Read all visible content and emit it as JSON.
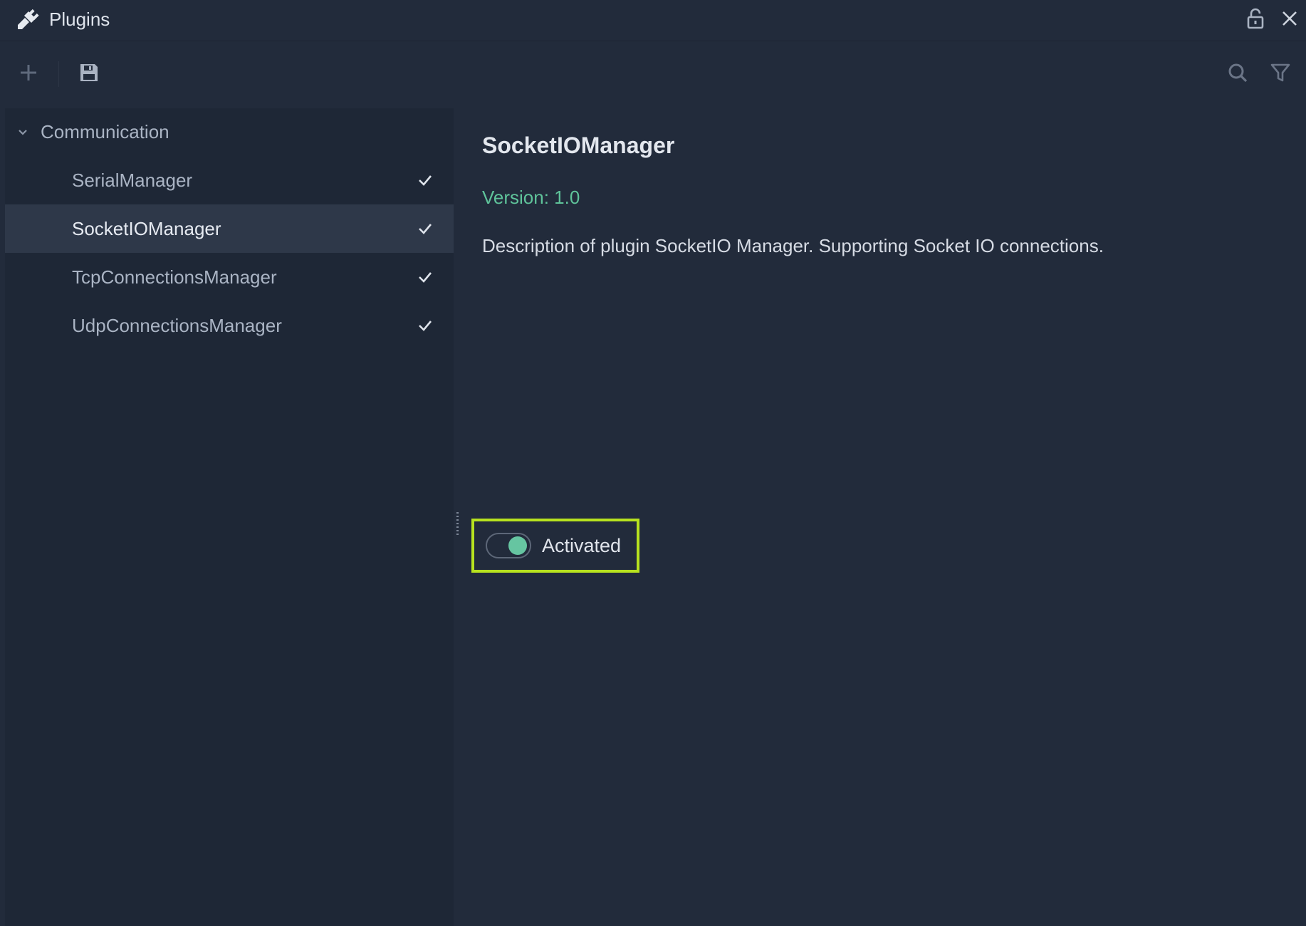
{
  "window": {
    "title": "Plugins",
    "icons": {
      "app": "plug-icon",
      "lock": "lock-icon",
      "close": "close-icon"
    }
  },
  "toolbar": {
    "icons": {
      "add": "plus-icon",
      "save": "save-icon",
      "search": "search-icon",
      "filter": "filter-icon"
    }
  },
  "sidebar": {
    "group": {
      "label": "Communication",
      "expanded": true,
      "icon": "chevron-down-icon"
    },
    "items": [
      {
        "label": "SerialManager",
        "checked": true,
        "selected": false
      },
      {
        "label": "SocketIOManager",
        "checked": true,
        "selected": true
      },
      {
        "label": "TcpConnectionsManager",
        "checked": true,
        "selected": false
      },
      {
        "label": "UdpConnectionsManager",
        "checked": true,
        "selected": false
      }
    ]
  },
  "detail": {
    "name": "SocketIOManager",
    "version": "Version: 1.0",
    "description": "Description of plugin SocketIO Manager. Supporting Socket IO connections.",
    "toggle": {
      "label": "Activated",
      "on": true
    }
  },
  "colors": {
    "background": "#222b3b",
    "sidebar": "#1e2736",
    "selected_row": "#2e3849",
    "accent_green": "#5fc39a",
    "highlight_border": "#b7e21f"
  }
}
